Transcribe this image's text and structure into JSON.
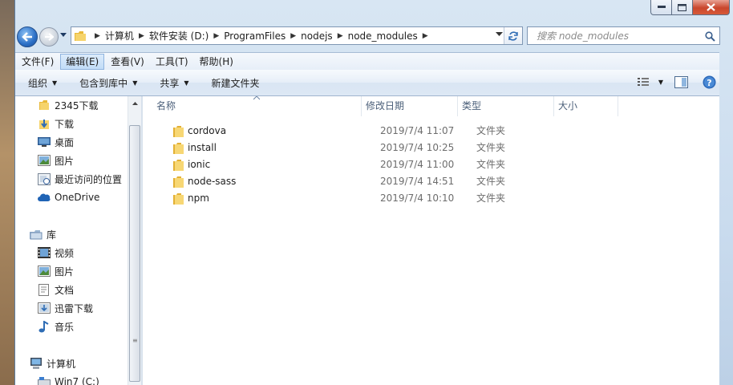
{
  "address": {
    "crumbs": [
      "计算机",
      "软件安装 (D:)",
      "ProgramFiles",
      "nodejs",
      "node_modules"
    ]
  },
  "search": {
    "placeholder": "搜索 node_modules"
  },
  "menu": {
    "items": [
      {
        "label": "文件(F)"
      },
      {
        "label": "编辑(E)"
      },
      {
        "label": "查看(V)"
      },
      {
        "label": "工具(T)"
      },
      {
        "label": "帮助(H)"
      }
    ],
    "active_index": 1
  },
  "toolbar": {
    "organize": "组织",
    "include_library": "包含到库中",
    "share": "共享",
    "new_folder": "新建文件夹"
  },
  "sidebar": {
    "items": [
      {
        "label": "2345下载",
        "icon": "folder-icon"
      },
      {
        "label": "下载",
        "icon": "download-folder-icon"
      },
      {
        "label": "桌面",
        "icon": "desktop-icon"
      },
      {
        "label": "图片",
        "icon": "pictures-icon"
      },
      {
        "label": "最近访问的位置",
        "icon": "recent-places-icon"
      },
      {
        "label": "OneDrive",
        "icon": "onedrive-cloud-icon"
      },
      {
        "label": "库",
        "icon": "library-icon",
        "group": true
      },
      {
        "label": "视频",
        "icon": "video-icon"
      },
      {
        "label": "图片",
        "icon": "pictures-icon"
      },
      {
        "label": "文档",
        "icon": "documents-icon"
      },
      {
        "label": "迅雷下载",
        "icon": "thunder-download-icon"
      },
      {
        "label": "音乐",
        "icon": "music-icon"
      },
      {
        "label": "计算机",
        "icon": "computer-icon",
        "group": true
      },
      {
        "label": "Win7 (C:)",
        "icon": "drive-icon"
      }
    ]
  },
  "columns": {
    "name": "名称",
    "modified": "修改日期",
    "type": "类型",
    "size": "大小"
  },
  "files": [
    {
      "name": "cordova",
      "modified": "2019/7/4 11:07",
      "type": "文件夹"
    },
    {
      "name": "install",
      "modified": "2019/7/4 10:25",
      "type": "文件夹"
    },
    {
      "name": "ionic",
      "modified": "2019/7/4 11:00",
      "type": "文件夹"
    },
    {
      "name": "node-sass",
      "modified": "2019/7/4 14:51",
      "type": "文件夹"
    },
    {
      "name": "npm",
      "modified": "2019/7/4 10:10",
      "type": "文件夹"
    }
  ],
  "colors": {
    "folder": "#f2c94c",
    "accent": "#3b7ddd",
    "close": "#c9462c"
  }
}
